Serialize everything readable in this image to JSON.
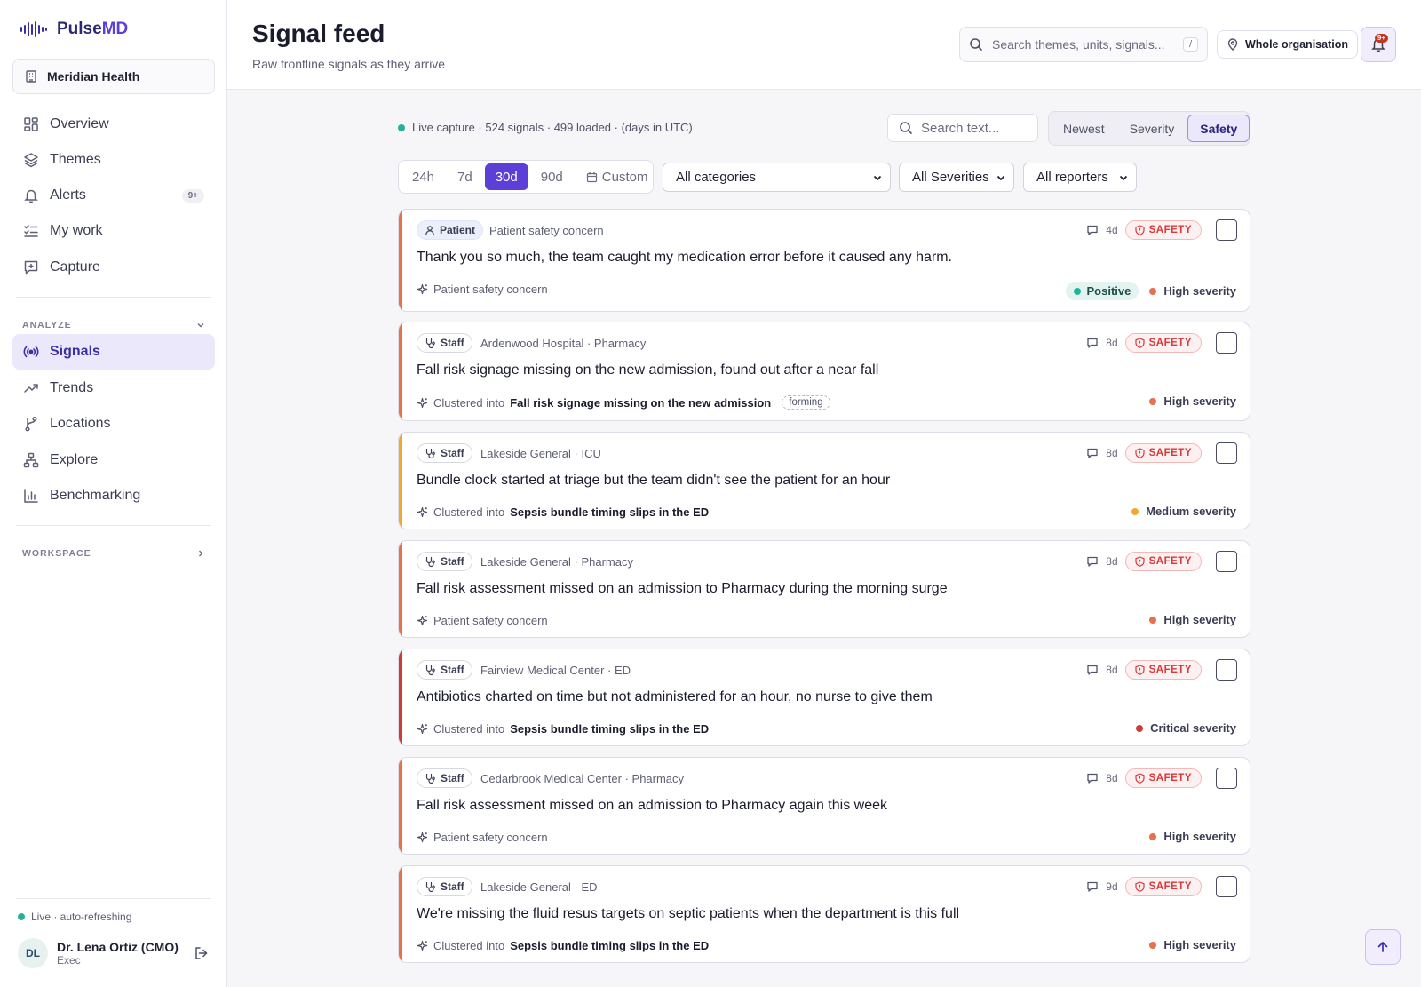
{
  "app": {
    "logo_a": "Pulse",
    "logo_b": "MD",
    "org": "Meridian Health"
  },
  "sidebar": {
    "primary": [
      {
        "label": "Overview",
        "icon": "overview-grid-icon"
      },
      {
        "label": "Themes",
        "icon": "layers-icon"
      },
      {
        "label": "Alerts",
        "icon": "bell-icon",
        "badge": "9+"
      },
      {
        "label": "My work",
        "icon": "checklist-icon"
      },
      {
        "label": "Capture",
        "icon": "message-plus-icon"
      }
    ],
    "section_analyze": "ANALYZE",
    "analyze": [
      {
        "label": "Signals",
        "icon": "broadcast-icon",
        "active": true
      },
      {
        "label": "Trends",
        "icon": "trend-icon"
      },
      {
        "label": "Locations",
        "icon": "branch-icon"
      },
      {
        "label": "Explore",
        "icon": "hierarchy-icon"
      },
      {
        "label": "Benchmarking",
        "icon": "bar-chart-icon"
      }
    ],
    "section_workspace": "WORKSPACE",
    "live_status": "Live · auto-refreshing",
    "user": {
      "initials": "DL",
      "name": "Dr. Lena Ortiz (CMO)",
      "role": "Exec"
    }
  },
  "header": {
    "title": "Signal feed",
    "subtitle": "Raw frontline signals as they arrive",
    "search_placeholder": "Search themes, units, signals...",
    "search_kbd": "/",
    "scope": "Whole organisation",
    "notif_badge": "9+"
  },
  "toolbar": {
    "status": "Live capture · 524 signals · 499 loaded · (days in UTC)",
    "search_placeholder": "Search text...",
    "sort": [
      "Newest",
      "Severity",
      "Safety"
    ],
    "sort_active": "Safety",
    "ranges": [
      "24h",
      "7d",
      "30d",
      "90d",
      "Custom"
    ],
    "range_active": "30d",
    "category": "All categories",
    "severity": "All Severities",
    "reporter": "All reporters"
  },
  "colors": {
    "accent": "#5b3fd6",
    "high": "#e8704a",
    "medium": "#f0a830",
    "critical": "#d23a3a",
    "live": "#22b39a"
  },
  "signals": [
    {
      "reporter": "Patient",
      "location": "Patient safety concern",
      "age": "4d",
      "badge": "SAFETY",
      "text": "Thank you so much, the team caught my medication error before it caused any harm.",
      "foot_plain": "Patient safety concern",
      "sentiment": "Positive",
      "severity": "High severity",
      "level": "high"
    },
    {
      "reporter": "Staff",
      "location": "Ardenwood Hospital · Pharmacy",
      "age": "8d",
      "badge": "SAFETY",
      "text": "Fall risk signage missing on the new admission, found out after a near fall",
      "clustered_prefix": "Clustered into",
      "cluster": "Fall risk signage missing on the new admission",
      "forming": "forming",
      "severity": "High severity",
      "level": "high"
    },
    {
      "reporter": "Staff",
      "location": "Lakeside General · ICU",
      "age": "8d",
      "badge": "SAFETY",
      "text": "Bundle clock started at triage but the team didn't see the patient for an hour",
      "clustered_prefix": "Clustered into",
      "cluster": "Sepsis bundle timing slips in the ED",
      "severity": "Medium severity",
      "level": "medium"
    },
    {
      "reporter": "Staff",
      "location": "Lakeside General · Pharmacy",
      "age": "8d",
      "badge": "SAFETY",
      "text": "Fall risk assessment missed on an admission to Pharmacy during the morning surge",
      "foot_plain": "Patient safety concern",
      "severity": "High severity",
      "level": "high"
    },
    {
      "reporter": "Staff",
      "location": "Fairview Medical Center · ED",
      "age": "8d",
      "badge": "SAFETY",
      "text": "Antibiotics charted on time but not administered for an hour, no nurse to give them",
      "clustered_prefix": "Clustered into",
      "cluster": "Sepsis bundle timing slips in the ED",
      "severity": "Critical severity",
      "level": "critical"
    },
    {
      "reporter": "Staff",
      "location": "Cedarbrook Medical Center · Pharmacy",
      "age": "8d",
      "badge": "SAFETY",
      "text": "Fall risk assessment missed on an admission to Pharmacy again this week",
      "foot_plain": "Patient safety concern",
      "severity": "High severity",
      "level": "high"
    },
    {
      "reporter": "Staff",
      "location": "Lakeside General · ED",
      "age": "9d",
      "badge": "SAFETY",
      "text": "We're missing the fluid resus targets on septic patients when the department is this full",
      "clustered_prefix": "Clustered into",
      "cluster": "Sepsis bundle timing slips in the ED",
      "severity": "High severity",
      "level": "high"
    }
  ]
}
